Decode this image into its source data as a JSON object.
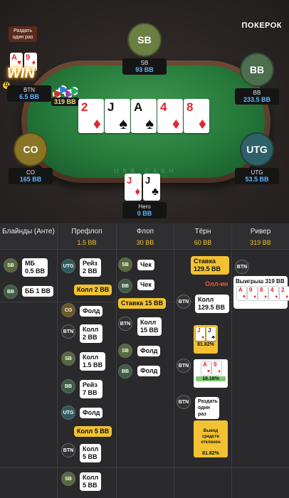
{
  "brand": "ПОКЕРОК",
  "tooltip": "Раздать один раз",
  "win_badge": "WIN",
  "dealer_button": "D",
  "felt_text": "USB CASH",
  "pot": "319 BB",
  "seats": {
    "sb": {
      "avatar": "SB",
      "name": "SB",
      "stack": "93 BB",
      "color": "#6b7e43"
    },
    "bb": {
      "avatar": "BB",
      "name": "BB",
      "stack": "233.5 BB",
      "color": "#4c6e4f"
    },
    "utg": {
      "avatar": "UTG",
      "name": "UTG",
      "stack": "53.5 BB",
      "color": "#2f6268"
    },
    "co": {
      "avatar": "CO",
      "name": "CO",
      "stack": "165 BB",
      "color": "#8a7426"
    },
    "btn": {
      "name": "BTN",
      "stack": "6.5 BB"
    },
    "hero": {
      "name": "Hero",
      "stack": "0 BB"
    }
  },
  "winner_cards": [
    {
      "rank": "A",
      "suit": "♥"
    },
    {
      "rank": "9",
      "suit": "♦"
    }
  ],
  "board": [
    {
      "rank": "2",
      "suit": "♦"
    },
    {
      "rank": "J",
      "suit": "♠"
    },
    {
      "rank": "A",
      "suit": "♠"
    },
    {
      "rank": "4",
      "suit": "♦"
    },
    {
      "rank": "8",
      "suit": "♦"
    }
  ],
  "hero_cards": [
    {
      "rank": "J",
      "suit": "♦"
    },
    {
      "rank": "J",
      "suit": "♣"
    }
  ],
  "history": {
    "columns": [
      {
        "street": "Блайнды (Анте)",
        "pot": ""
      },
      {
        "street": "Префлоп",
        "pot": "1.5 BB"
      },
      {
        "street": "Флоп",
        "pot": "30 BB"
      },
      {
        "street": "Тёрн",
        "pot": "60 BB"
      },
      {
        "street": "Ривер",
        "pot": "319 BB"
      }
    ],
    "blinds": [
      {
        "pos": "SB",
        "text": "МБ 0.5 BB"
      },
      {
        "pos": "BB",
        "text": "ББ 1 BB"
      }
    ],
    "preflop": [
      {
        "pos": "UTG",
        "text": "Рейз 2 BB"
      },
      {
        "text": "Колл 2 BB"
      },
      {
        "pos": "CO",
        "text": "Фолд"
      },
      {
        "pos": "BTN",
        "text": "Колл 2 BB"
      },
      {
        "pos": "SB",
        "text": "Колл 1.5 BB"
      },
      {
        "pos": "BB",
        "text": "Рейз 7 BB"
      },
      {
        "pos": "UTG",
        "text": "Фолд"
      },
      {
        "text": "Колл 5 BB"
      },
      {
        "pos": "BTN",
        "text": "Колл 5 BB"
      },
      {
        "pos": "SB",
        "text": "Колл 5 BB"
      }
    ],
    "flop": [
      {
        "pos": "SB",
        "text": "Чек"
      },
      {
        "pos": "BB",
        "text": "Чек"
      },
      {
        "text": "Ставка 15 BB"
      },
      {
        "pos": "BTN",
        "text": "Колл 15 BB"
      },
      {
        "pos": "SB",
        "text": "Фолд"
      },
      {
        "pos": "BB",
        "text": "Фолд"
      }
    ],
    "turn": {
      "bet": "Ставка 129.5 BB",
      "allin": "Олл-ин",
      "call_pos": "BTN",
      "call": "Колл 129.5 BB",
      "hero_equity": "81.82%",
      "hero_cards": [
        {
          "rank": "J",
          "suit": "♦"
        },
        {
          "rank": "J",
          "suit": "♣"
        }
      ],
      "villain_pos": "BTN",
      "villain_equity": "18.18%",
      "villain_cards": [
        {
          "rank": "A",
          "suit": "♥"
        },
        {
          "rank": "9",
          "suit": "♦"
        }
      ],
      "runit_pos": "BTN",
      "runit_text": "Раздать один раз",
      "ev_text": "Вывод средств отклонен",
      "ev_value": "81.82%"
    },
    "river": {
      "pos": "BTN",
      "win_text": "Выигрыш 319 BB",
      "cards": [
        {
          "rank": "A",
          "suit": "♥"
        },
        {
          "rank": "9",
          "suit": "♦"
        },
        {
          "rank": "8",
          "suit": "♦"
        },
        {
          "rank": "4",
          "suit": "♦"
        },
        {
          "rank": "2",
          "suit": "♦"
        }
      ]
    }
  }
}
